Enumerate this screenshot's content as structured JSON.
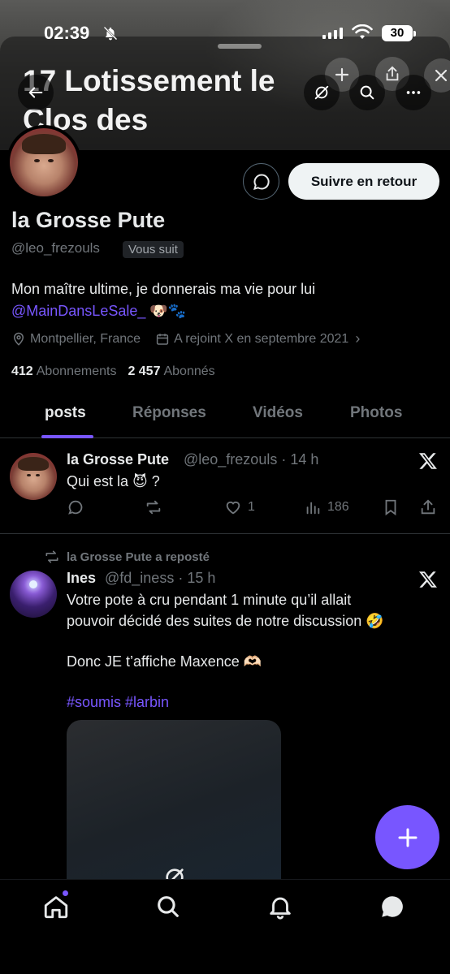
{
  "status_bar": {
    "time": "02:39",
    "battery": "30"
  },
  "header": {
    "title": "17 Lotissement le Clos des"
  },
  "profile": {
    "display_name": "la Grosse Pute",
    "handle": "@leo_frezouls",
    "follows_you": "Vous suit",
    "follow_button": "Suivre en retour",
    "bio_text": "Mon maître ultime, je donnerais ma vie pour lui",
    "bio_mention": "@MainDansLeSale_",
    "bio_emoji": "🐶🐾",
    "location": "Montpellier, France",
    "joined": "A rejoint X en septembre 2021",
    "following_count": "412",
    "following_label": "Abonnements",
    "followers_count": "2 457",
    "followers_label": "Abonnés"
  },
  "tabs": [
    {
      "label": "posts"
    },
    {
      "label": "Réponses"
    },
    {
      "label": "Vidéos"
    },
    {
      "label": "Photos"
    }
  ],
  "posts": [
    {
      "name": "la Grosse Pute",
      "handle": "@leo_frezouls",
      "time": "· 14 h",
      "text": "Qui est la 😈 ?",
      "likes": "1",
      "views": "186"
    },
    {
      "repost_label": "la Grosse Pute a reposté",
      "name": "Ines",
      "handle": "@fd_iness",
      "time": "· 15 h",
      "text_line1": "Votre pote à cru pendant 1 minute qu’il allait",
      "text_line2": "pouvoir décidé des suites de notre discussion 🤣",
      "text_line3": "Donc JE t’affiche Maxence 🫶🏻",
      "hashtags": "#soumis #larbin"
    }
  ],
  "colors": {
    "accent": "#7856ff",
    "background": "#000000",
    "muted": "#71767b"
  }
}
